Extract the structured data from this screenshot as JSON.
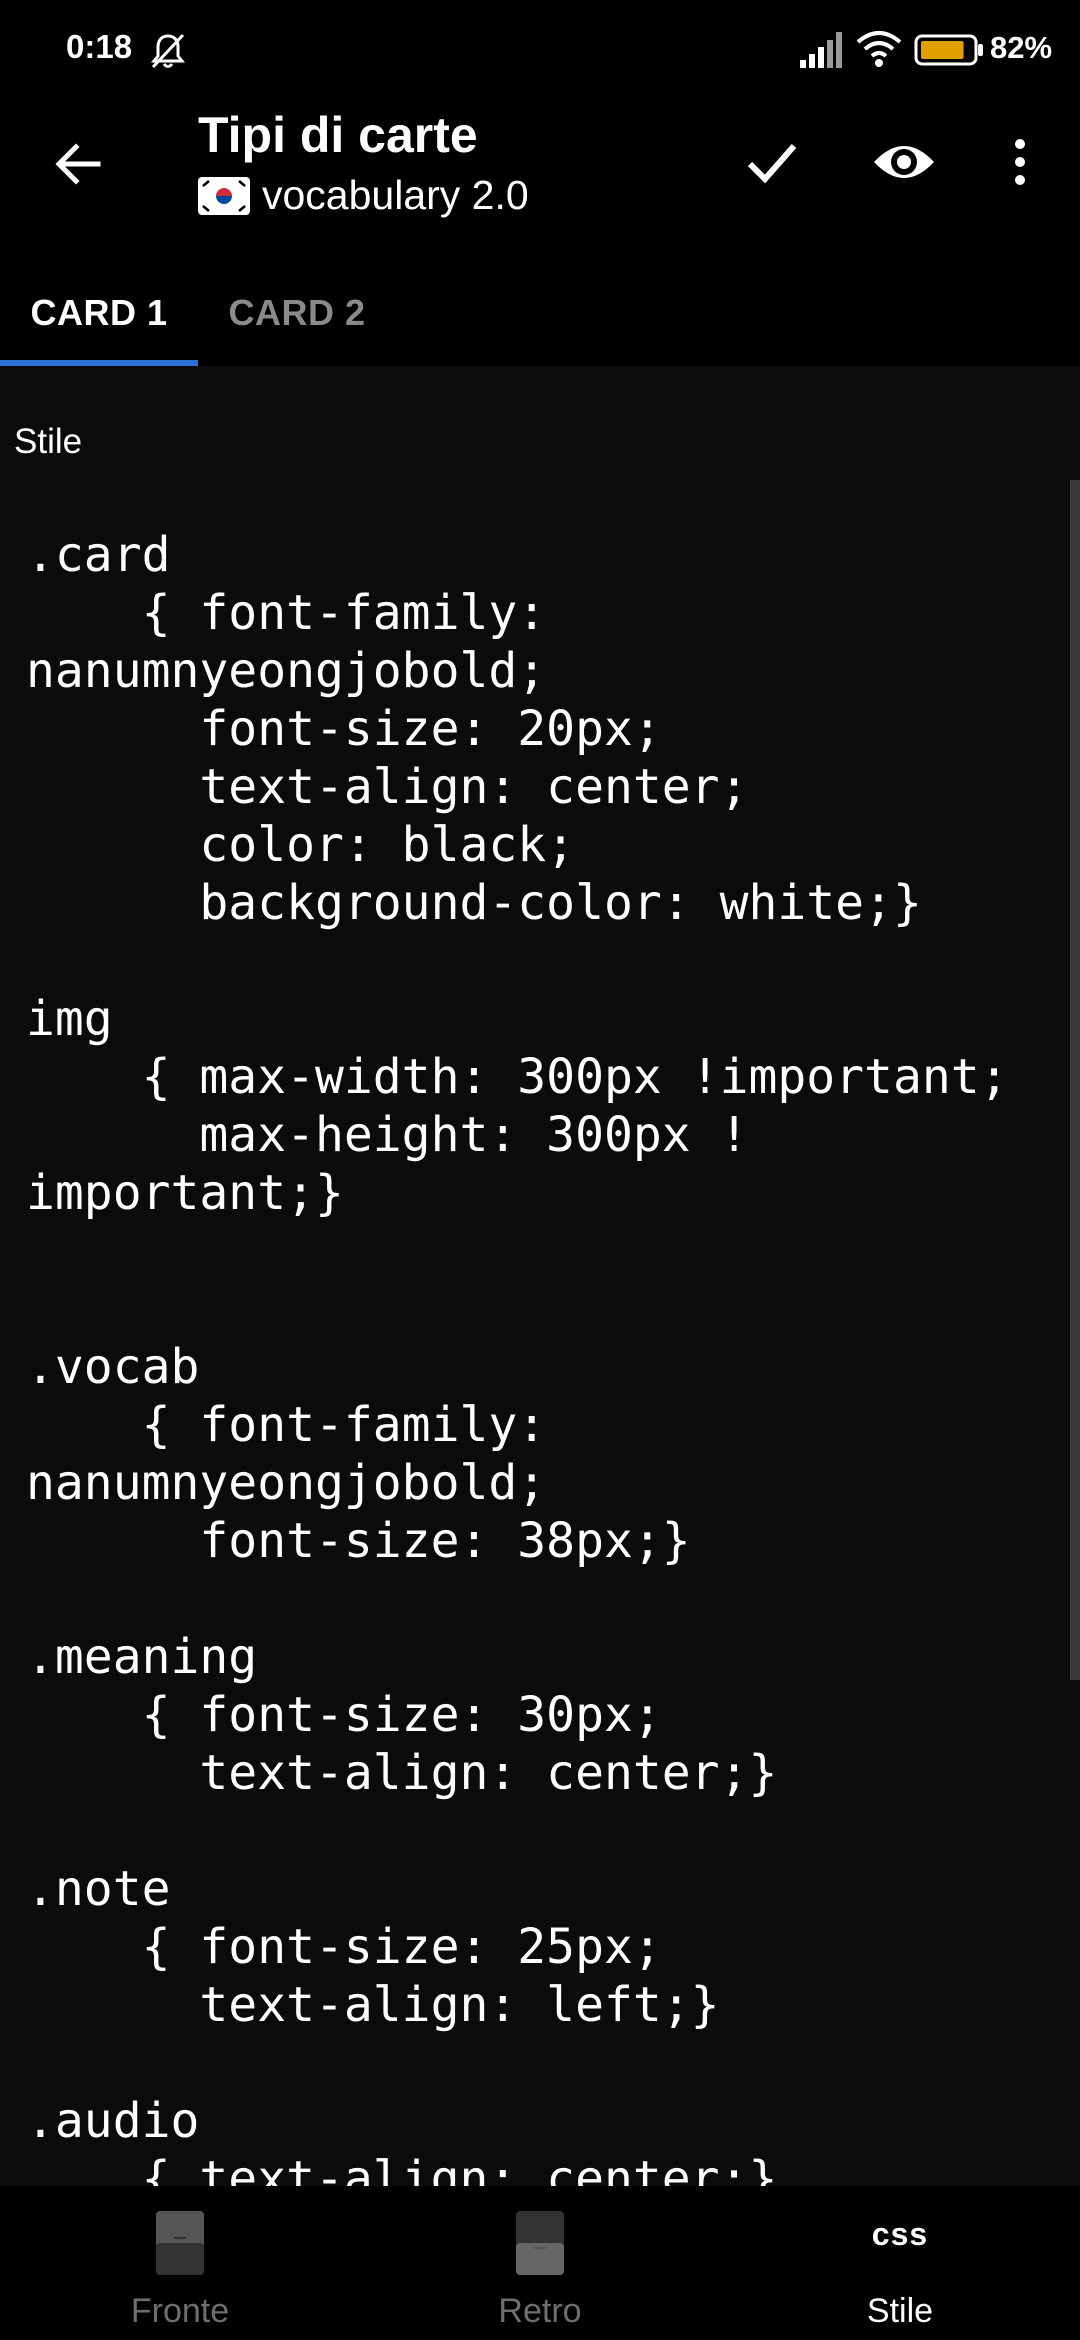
{
  "status_bar": {
    "time": "0:18",
    "battery_percent": "82%",
    "battery_level": 0.82,
    "icons": [
      "mute-icon",
      "signal-icon",
      "wifi-icon",
      "battery-icon"
    ]
  },
  "header": {
    "title": "Tipi di carte",
    "subtitle": "vocabulary 2.0",
    "flag": "south-korea-flag-icon",
    "actions": [
      "back-arrow-icon",
      "check-icon",
      "eye-icon",
      "more-vertical-icon"
    ]
  },
  "tabs": [
    {
      "label": "CARD 1",
      "selected": true
    },
    {
      "label": "CARD 2",
      "selected": false
    }
  ],
  "editor": {
    "label": "Stile",
    "code": ".card\n    { font-family:\nnanumnyeongjobold;\n      font-size: 20px;\n      text-align: center;\n      color: black;\n      background-color: white;}\n\nimg\n    { max-width: 300px !important;\n      max-height: 300px !\nimportant;}\n\n\n.vocab\n    { font-family:\nnanumnyeongjobold;\n      font-size: 38px;}\n\n.meaning\n    { font-size: 30px;\n      text-align: center;}\n\n.note\n    { font-size: 25px;\n      text-align: left;}\n\n.audio\n    { text-align: center;}"
  },
  "bottom_nav": {
    "front_label": "Fronte",
    "back_label": "Retro",
    "style_icon_text": "css",
    "style_label": "Stile",
    "selected": "Stile"
  },
  "colors": {
    "background": "#000000",
    "editor_background": "#0b0b0b",
    "tab_indicator": "#2d6fd4",
    "inactive_text": "#8a8a8a",
    "battery_fill": "#e0a000"
  }
}
